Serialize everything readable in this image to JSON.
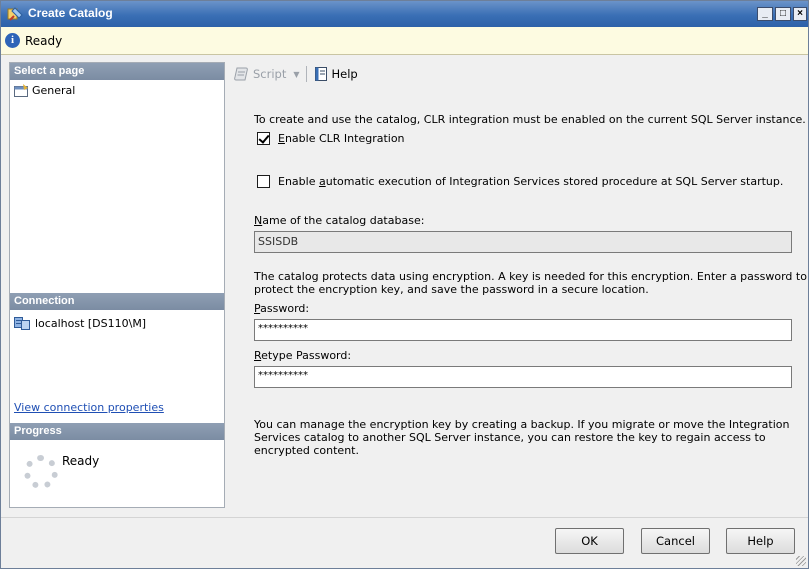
{
  "window": {
    "title": "Create Catalog",
    "minimize": "_",
    "maximize": "□",
    "close": "×"
  },
  "status": {
    "text": "Ready"
  },
  "left": {
    "select_header": "Select a page",
    "pages": [
      {
        "label": "General"
      }
    ],
    "connection_header": "Connection",
    "connection": "localhost [DS110\\M]",
    "view_link": "View connection properties",
    "progress_header": "Progress",
    "progress_text": "Ready"
  },
  "toolbar": {
    "script": "Script",
    "help": "Help"
  },
  "main": {
    "clr_intro": "To create and use the catalog, CLR integration must be enabled on the current SQL Server instance.",
    "enable_clr": {
      "prefix": "",
      "accel": "E",
      "rest": "nable CLR Integration",
      "checked": true
    },
    "auto_exec": {
      "prefix": "Enable ",
      "accel": "a",
      "rest": "utomatic execution of Integration Services stored procedure at SQL Server startup.",
      "checked": false
    },
    "db_name_label": {
      "accel": "N",
      "rest": "ame of the catalog database:"
    },
    "db_name_value": "SSISDB",
    "encrypt_line1": "The catalog protects data using encryption. A key is needed for this encryption. Enter a password to",
    "encrypt_line2": "protect the encryption key, and save the password in a secure location.",
    "password_label": {
      "accel": "P",
      "rest": "assword:"
    },
    "password_value": "**********",
    "retype_label": {
      "accel": "R",
      "rest": "etype Password:"
    },
    "retype_value": "**********",
    "note_line1": "You can manage the encryption key by creating a backup. If you migrate or move the Integration",
    "note_line2": "Services catalog to another SQL Server instance, you can restore the key to regain access to",
    "note_line3": "encrypted content."
  },
  "buttons": {
    "ok": "OK",
    "cancel": "Cancel",
    "help": "Help"
  }
}
